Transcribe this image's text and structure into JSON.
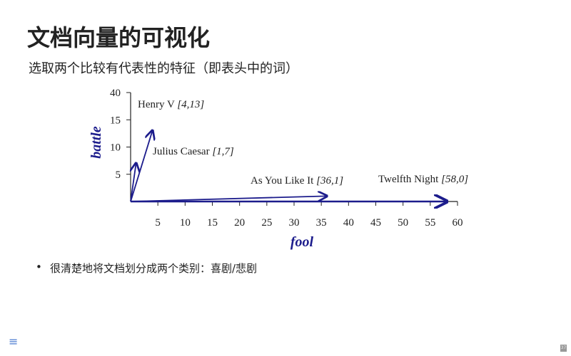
{
  "slide": {
    "title": "文档向量的可视化",
    "subtitle": "选取两个比较有代表性的特征（即表头中的词）",
    "bullets": [
      "很清楚地将文档划分成两个类别：喜剧/悲剧"
    ],
    "page_number": "37",
    "menu_icon": "hamburger-menu-icon"
  },
  "chart_data": {
    "type": "scatter",
    "title": "",
    "xlabel": "fool",
    "ylabel": "battle",
    "xlim": [
      0,
      60
    ],
    "ylim": [
      0,
      20
    ],
    "xticks": [
      "5",
      "10",
      "15",
      "20",
      "25",
      "30",
      "35",
      "40",
      "45",
      "50",
      "55",
      "60"
    ],
    "yticks": [
      "5",
      "10",
      "15",
      "40"
    ],
    "points": [
      {
        "label": "Henry V",
        "coords": "[4,13]",
        "x": 4,
        "y": 13
      },
      {
        "label": "Julius Caesar",
        "coords": "[1,7]",
        "x": 1,
        "y": 7
      },
      {
        "label": "As You Like It",
        "coords": "[36,1]",
        "x": 36,
        "y": 1
      },
      {
        "label": "Twelfth Night",
        "coords": "[58,0]",
        "x": 58,
        "y": 0
      }
    ],
    "color": "#1c1c8c"
  }
}
